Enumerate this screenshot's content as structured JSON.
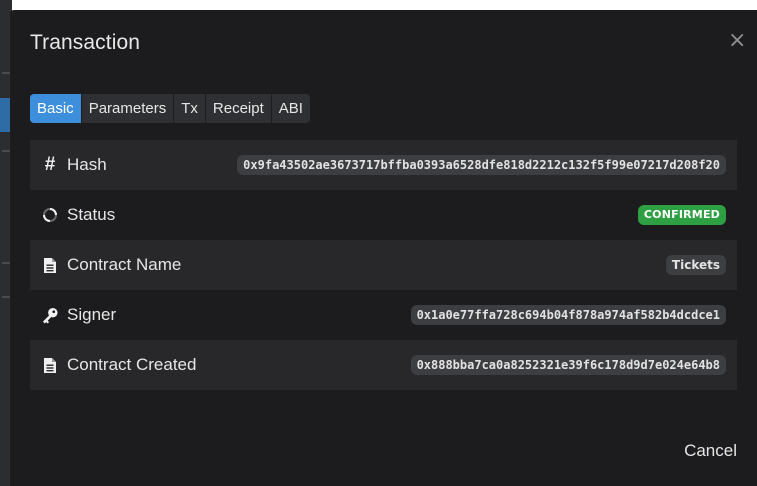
{
  "modal": {
    "title": "Transaction",
    "close_icon": "close-icon",
    "tabs": [
      {
        "label": "Basic",
        "active": true
      },
      {
        "label": "Parameters",
        "active": false
      },
      {
        "label": "Tx",
        "active": false
      },
      {
        "label": "Receipt",
        "active": false
      },
      {
        "label": "ABI",
        "active": false
      }
    ],
    "rows": [
      {
        "icon": "hash-icon",
        "label": "Hash",
        "value": "0x9fa43502ae3673717bffba0393a6528dfe818d2212c132f5f99e07217d208f20"
      },
      {
        "icon": "spinner-icon",
        "label": "Status",
        "value": "CONFIRMED"
      },
      {
        "icon": "document-icon",
        "label": "Contract Name",
        "value": "Tickets"
      },
      {
        "icon": "key-icon",
        "label": "Signer",
        "value": "0x1a0e77ffa728c694b04f878a974af582b4dcdce1"
      },
      {
        "icon": "document-icon",
        "label": "Contract Created",
        "value": "0x888bba7ca0a8252321e39f6c178d9d7e024e64b8"
      }
    ],
    "cancel_label": "Cancel"
  },
  "colors": {
    "modal_bg": "#1c1c1e",
    "row_shade": "#28282b",
    "accent": "#3d8fdb",
    "success": "#2ea043",
    "pill_bg": "#3d3e42"
  }
}
